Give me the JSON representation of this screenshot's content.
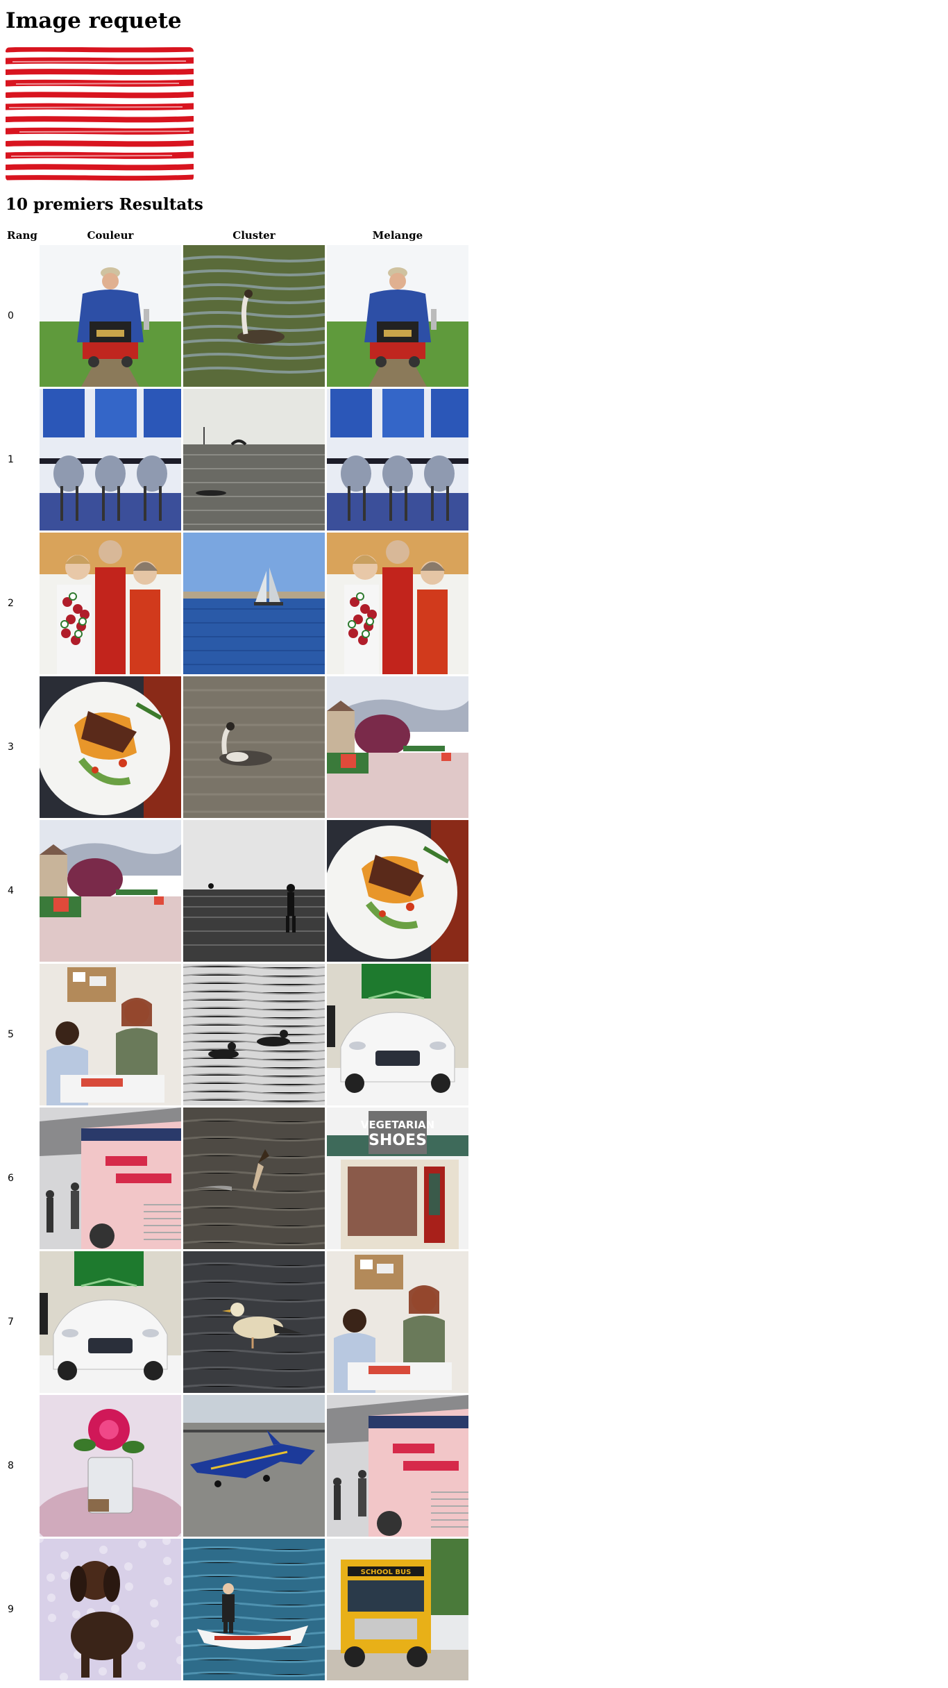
{
  "page": {
    "heading": "Image requete",
    "results_heading": "10 premiers Resultats"
  },
  "table": {
    "columns": [
      "Rang",
      "Couleur",
      "Cluster",
      "Melange"
    ],
    "rows": [
      {
        "rank": "0",
        "couleur": "man-on-miniature-train",
        "cluster": "grebe-on-water",
        "melange": "man-on-miniature-train"
      },
      {
        "rank": "1",
        "couleur": "chairs-by-window",
        "cluster": "sea-with-boat-and-dolphin",
        "melange": "chairs-by-window"
      },
      {
        "rank": "2",
        "couleur": "three-people-with-flowers",
        "cluster": "sailboat-on-blue-sea",
        "melange": "three-people-with-flowers"
      },
      {
        "rank": "3",
        "couleur": "food-plate",
        "cluster": "grebe-grey-water",
        "melange": "garden-path-houses"
      },
      {
        "rank": "4",
        "couleur": "garden-path-houses",
        "cluster": "person-on-beach-bw",
        "melange": "food-plate"
      },
      {
        "rank": "5",
        "couleur": "two-people-at-desk",
        "cluster": "loons-on-water",
        "melange": "white-car-showroom"
      },
      {
        "rank": "6",
        "couleur": "pink-bus-people",
        "cluster": "bird-landing-water",
        "melange": "vegetarian-shoes-store"
      },
      {
        "rank": "7",
        "couleur": "white-car-showroom",
        "cluster": "gull-in-water",
        "melange": "two-people-at-desk"
      },
      {
        "rank": "8",
        "couleur": "rose-in-bucket",
        "cluster": "blue-jet-on-tarmac",
        "melange": "pink-bus-people"
      },
      {
        "rank": "9",
        "couleur": "brown-dog",
        "cluster": "man-in-boat",
        "melange": "yellow-school-bus"
      }
    ]
  },
  "image_text": {
    "store_sign_line1": "VEGETARIAN",
    "store_sign_line2": "SHOES",
    "bus_sign": "SCHOOL BUS"
  },
  "colors": {
    "query_stripe": "#d8141f",
    "query_background": "#ffffff"
  }
}
